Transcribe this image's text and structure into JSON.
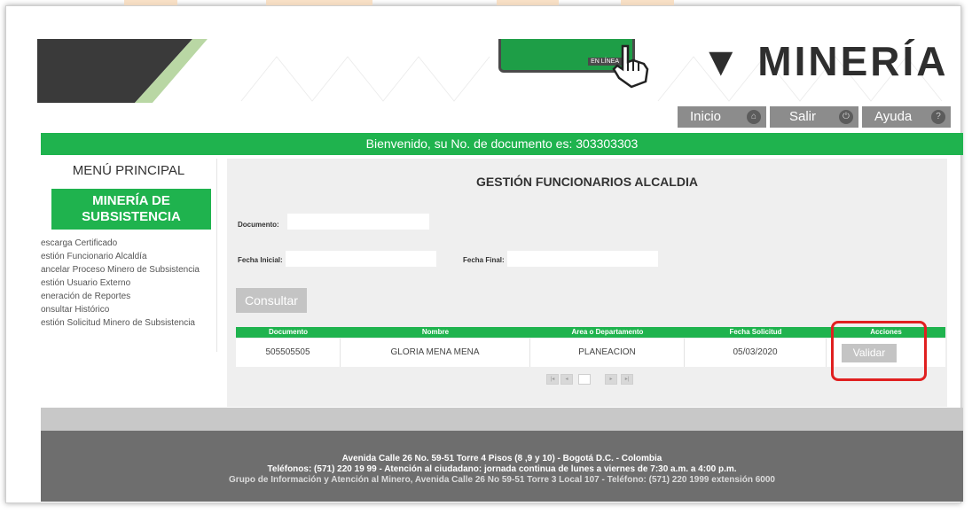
{
  "header": {
    "logo_sub": "EN LÍNEA",
    "brand_text": "▼ MINERÍA"
  },
  "nav": [
    {
      "label": "Inicio",
      "icon": "home-icon"
    },
    {
      "label": "Salir",
      "icon": "exit-icon"
    },
    {
      "label": "Ayuda",
      "icon": "help-icon"
    }
  ],
  "welcome": "Bienvenido, su No. de documento es: 303303303",
  "sidebar": {
    "title": "MENÚ PRINCIPAL",
    "section_line1": "MINERÍA DE",
    "section_line2": "SUBSISTENCIA",
    "items": [
      "escarga Certificado",
      "estión Funcionario Alcaldía",
      "ancelar Proceso Minero de Subsistencia",
      "estión Usuario Externo",
      "eneración de Reportes",
      "onsultar Histórico",
      "estión Solicitud Minero de Subsistencia"
    ]
  },
  "main": {
    "title": "GESTIÓN FUNCIONARIOS ALCALDIA",
    "documento_label": "Documento:",
    "fecha_inicial_label": "Fecha Inicial:",
    "fecha_final_label": "Fecha Final:",
    "consultar_label": "Consultar",
    "table": {
      "headers": [
        "Documento",
        "Nombre",
        "Area o Departamento",
        "Fecha Solicitud",
        "Acciones"
      ],
      "rows": [
        {
          "documento": "505505505",
          "nombre": "GLORIA MENA MENA",
          "area": "PLANEACION",
          "fecha": "05/03/2020",
          "accion": "Validar"
        }
      ]
    }
  },
  "footer": {
    "line1": "Avenida Calle 26 No. 59-51 Torre 4 Pisos (8 ,9 y 10) - Bogotá D.C. - Colombia",
    "line2": "Teléfonos: (571) 220 19 99 - Atención al ciudadano: jornada continua de lunes a viernes de 7:30 a.m. a 4:00 p.m.",
    "line3": "Grupo de Información y Atención al Minero, Avenida Calle 26 No 59-51 Torre 3 Local 107 - Teléfono: (571) 220 1999 extensión 6000"
  },
  "colors": {
    "brand_green": "#1fb34e",
    "nav_gray": "#8c8c8c",
    "footer_gray": "#6e6e6e",
    "highlight_red": "#e02020"
  }
}
